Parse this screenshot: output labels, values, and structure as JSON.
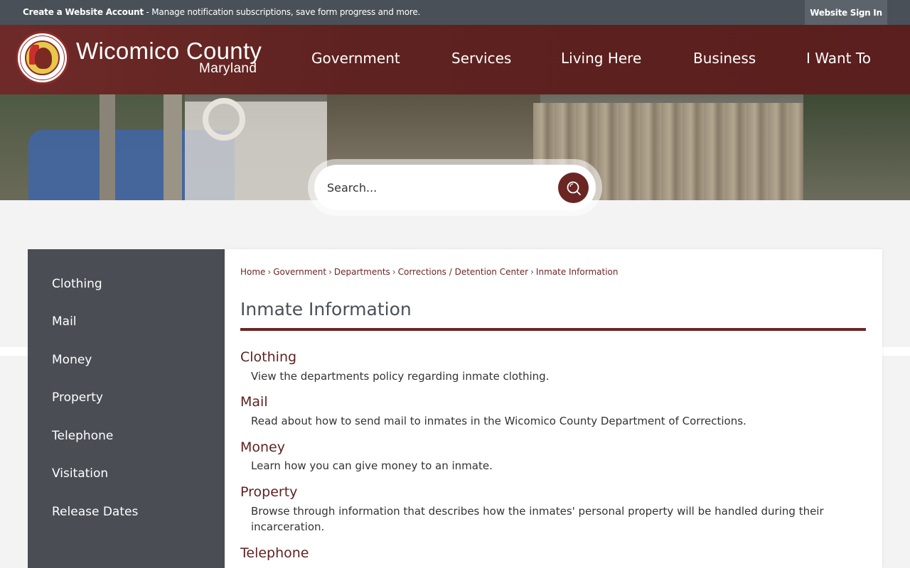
{
  "topbar": {
    "message_bold": "Create a Website Account",
    "message_rest": " - Manage notification subscriptions, save form progress and more.",
    "signin_label": "Website Sign In"
  },
  "brand": {
    "title": "Wicomico County",
    "subtitle": "Maryland"
  },
  "nav": {
    "items": [
      "Government",
      "Services",
      "Living Here",
      "Business",
      "I Want To"
    ]
  },
  "search": {
    "placeholder": "Search..."
  },
  "sidebar": {
    "items": [
      "Clothing",
      "Mail",
      "Money",
      "Property",
      "Telephone",
      "Visitation",
      "Release Dates"
    ]
  },
  "breadcrumb": {
    "items": [
      "Home",
      "Government",
      "Departments",
      "Corrections / Detention Center",
      "Inmate Information"
    ],
    "separator": "›"
  },
  "page": {
    "title": "Inmate Information"
  },
  "entries": [
    {
      "title": "Clothing",
      "desc": "View the departments policy regarding inmate clothing."
    },
    {
      "title": "Mail",
      "desc": "Read about how to send mail to inmates in the Wicomico County Department of Corrections."
    },
    {
      "title": "Money",
      "desc": "Learn how you can give money to an inmate."
    },
    {
      "title": "Property",
      "desc": "Browse through information that describes how the inmates' personal property will be handled during their incarceration."
    },
    {
      "title": "Telephone",
      "desc": ""
    }
  ],
  "colors": {
    "brand_maroon": "#6b2624",
    "topbar_gray": "#4a5058",
    "sidebar_gray": "#4a4e54"
  }
}
